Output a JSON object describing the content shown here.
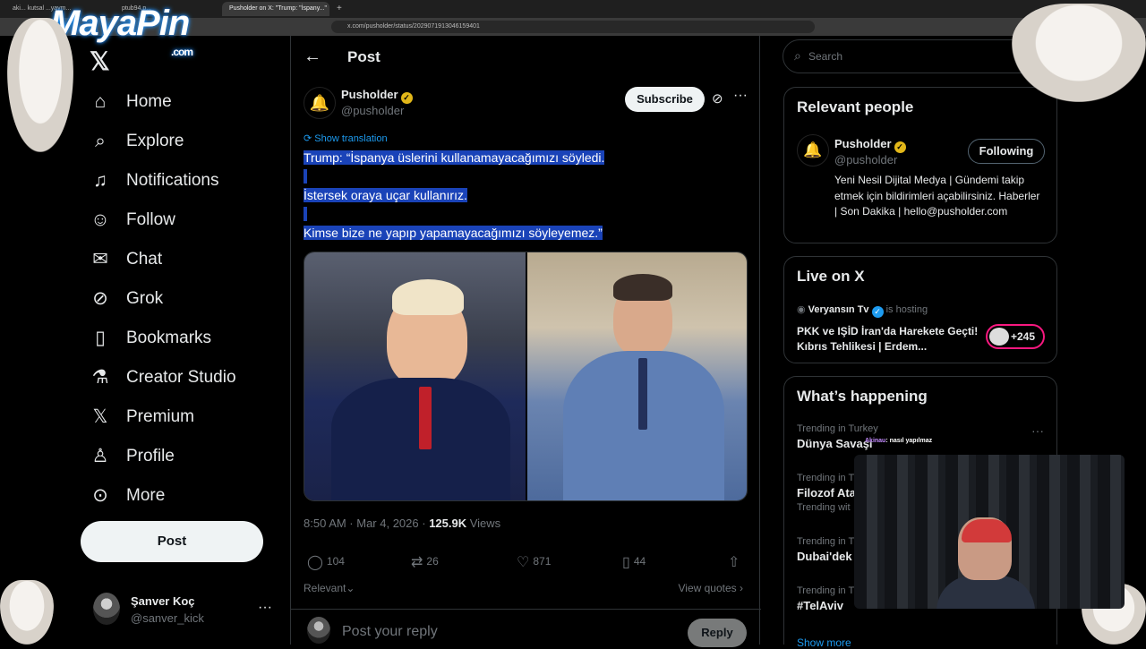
{
  "browser": {
    "tabs": [
      {
        "label": "aki... kutsal ...yaym..."
      },
      {
        "label": "ptub94.p..."
      },
      {
        "label": "Pusholder on X: \"Trump: \"İspany...\""
      }
    ],
    "new_tab": "+",
    "url": "x.com/pusholder/status/2029071913046159401"
  },
  "overlay": {
    "logo": "MayaPin",
    "logo_sub": ".com",
    "chat_user": "Akinau",
    "chat_text": ": nasıl yapılmaz"
  },
  "nav": {
    "items": [
      {
        "label": "Home",
        "icon": "home-icon",
        "glyph": "⌂"
      },
      {
        "label": "Explore",
        "icon": "search-icon",
        "glyph": "⌕"
      },
      {
        "label": "Notifications",
        "icon": "bell-icon",
        "glyph": "🔔"
      },
      {
        "label": "Follow",
        "icon": "add-person-icon",
        "glyph": "👤"
      },
      {
        "label": "Chat",
        "icon": "mail-icon",
        "glyph": "✉"
      },
      {
        "label": "Grok",
        "icon": "grok-icon",
        "glyph": "⊘"
      },
      {
        "label": "Bookmarks",
        "icon": "bookmark-icon",
        "glyph": "🔖"
      },
      {
        "label": "Creator Studio",
        "icon": "flask-icon",
        "glyph": "⚗"
      },
      {
        "label": "Premium",
        "icon": "x-icon",
        "glyph": "𝕏"
      },
      {
        "label": "Profile",
        "icon": "profile-icon",
        "glyph": "👤"
      },
      {
        "label": "More",
        "icon": "more-circle-icon",
        "glyph": "⋯"
      }
    ],
    "post_button": "Post",
    "user": {
      "name": "Şanver Koç",
      "handle": "@sanver_kick",
      "menu": "···"
    }
  },
  "post": {
    "header_title": "Post",
    "author": {
      "name": "Pusholder",
      "handle": "@pusholder"
    },
    "subscribe": "Subscribe",
    "show_translation": "Show translation",
    "lines": [
      "Trump: “İspanya üslerini kullanamayacağımızı söyledi.",
      "İstersek oraya uçar kullanırız.",
      "Kimse bize ne yapıp yapamayacağımızı söyleyemez.”"
    ],
    "meta_time": "8:50 AM · Mar 4, 2026 · ",
    "views_count": "125.9K",
    "views_label": " Views",
    "stats": {
      "replies": "104",
      "reposts": "26",
      "likes": "871",
      "bookmarks": "44"
    },
    "relevant": "Relevant",
    "view_quotes": "View quotes",
    "reply_placeholder": "Post your reply",
    "reply_button": "Reply"
  },
  "sidebar": {
    "search_placeholder": "Search",
    "relevant_people": {
      "title": "Relevant people",
      "name": "Pusholder",
      "handle": "@pusholder",
      "button": "Following",
      "bio": "Yeni Nesil Dijital Medya | Gündemi takip etmek için bildirimleri açabilirsiniz. Haberler | Son Dakika | hello@pusholder.com"
    },
    "live": {
      "title": "Live on X",
      "host": "Veryansın Tv",
      "host_suffix": "is hosting",
      "broadcast": "PKK ve IŞİD İran'da Harekete Geçti! Kıbrıs Tehlikesi | Erdem...",
      "listeners": "+245"
    },
    "happening": {
      "title": "What’s happening",
      "trends": [
        {
          "category": "Trending in Turkey",
          "title": "Dünya Savaşı",
          "sub": ""
        },
        {
          "category": "Trending in T",
          "title": "Filozof Ata",
          "sub": "Trending wit"
        },
        {
          "category": "Trending in T",
          "title": "Dubai'dek",
          "sub": ""
        },
        {
          "category": "Trending in T",
          "title": "#TelAviv",
          "sub": ""
        }
      ],
      "show_more": "Show more"
    }
  },
  "colors": {
    "accent": "#1d9bf0",
    "selection": "#1a43b8",
    "verified_gold": "#e2b719",
    "live_pink": "#f91880"
  }
}
